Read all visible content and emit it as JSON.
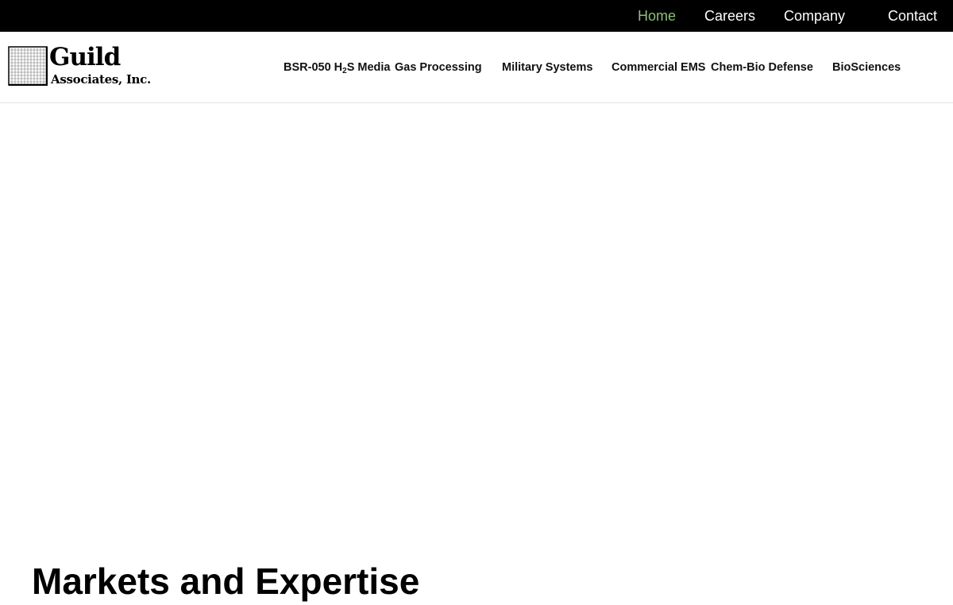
{
  "topnav": {
    "items": [
      {
        "label": "Home",
        "active": true
      },
      {
        "label": "Careers",
        "active": false
      },
      {
        "label": "Company",
        "active": false
      },
      {
        "label": "Contact",
        "active": false
      }
    ],
    "active_color": "#8cbf7a"
  },
  "logo": {
    "line1": "Guild",
    "line2": "Associates, Inc."
  },
  "mainnav": {
    "items": [
      {
        "label_pre": "BSR-050 H",
        "label_sub": "2",
        "label_post": "S Media"
      },
      {
        "label": "Gas Processing"
      },
      {
        "label": "Military Systems"
      },
      {
        "label": "Commercial EMS"
      },
      {
        "label": "Chem-Bio Defense"
      },
      {
        "label": "BioSciences"
      }
    ]
  },
  "main": {
    "section_title": "Markets and Expertise"
  }
}
